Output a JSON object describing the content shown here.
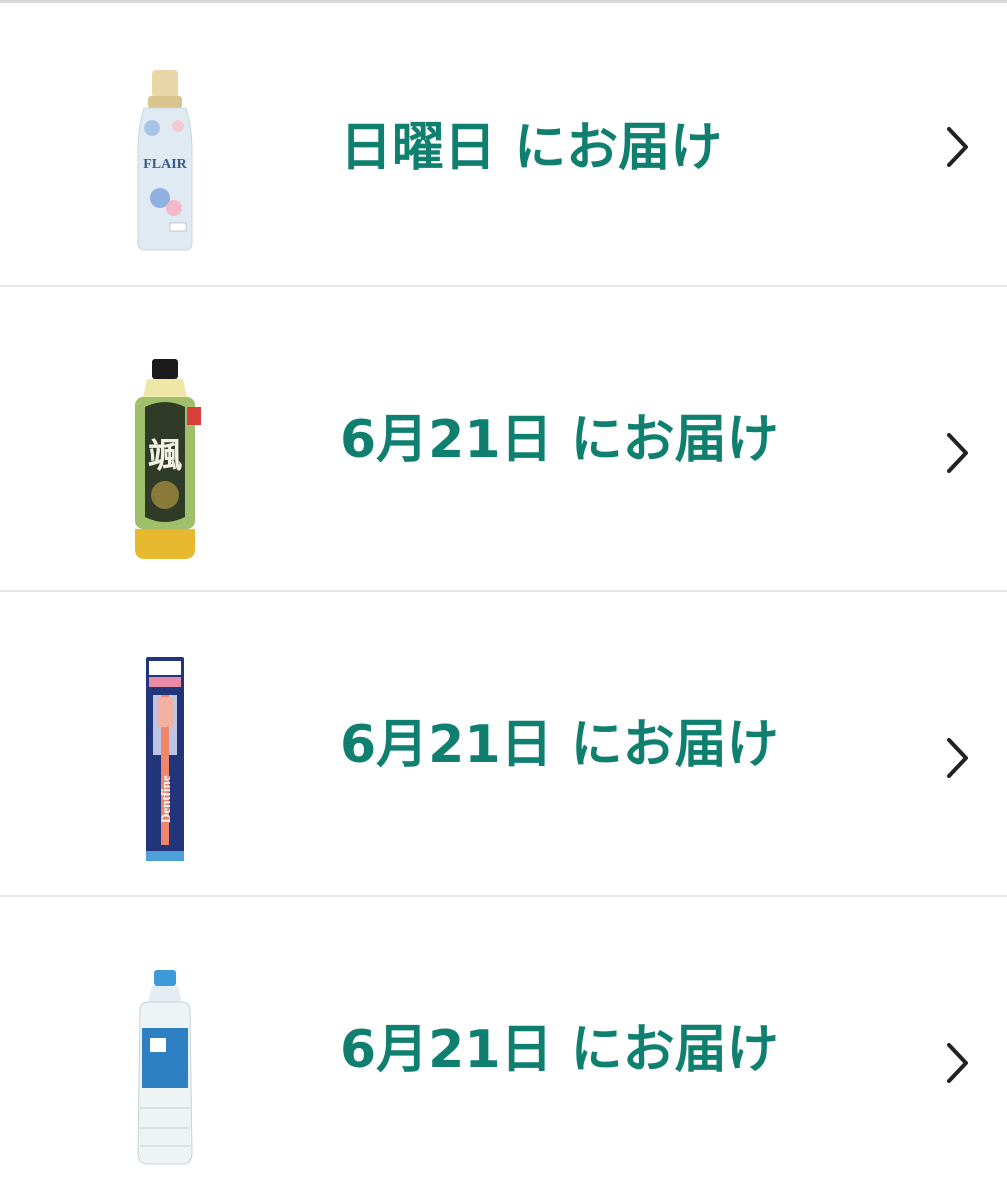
{
  "orders": [
    {
      "delivery_label": "日曜日 にお届け",
      "product_icon": "fabric-softener-bottle-icon",
      "product_text": "FLAIR"
    },
    {
      "delivery_label": "6月21日 にお届け",
      "product_icon": "green-tea-bottle-icon",
      "product_text": "颯"
    },
    {
      "delivery_label": "6月21日 にお届け",
      "product_icon": "toothbrush-package-icon",
      "product_text": "Dentfine"
    },
    {
      "delivery_label": "6月21日 にお届け",
      "product_icon": "water-bottle-icon",
      "product_text": ""
    }
  ],
  "colors": {
    "label": "#0f7f6f",
    "divider": "#e6e6e6",
    "chevron": "#222222"
  }
}
